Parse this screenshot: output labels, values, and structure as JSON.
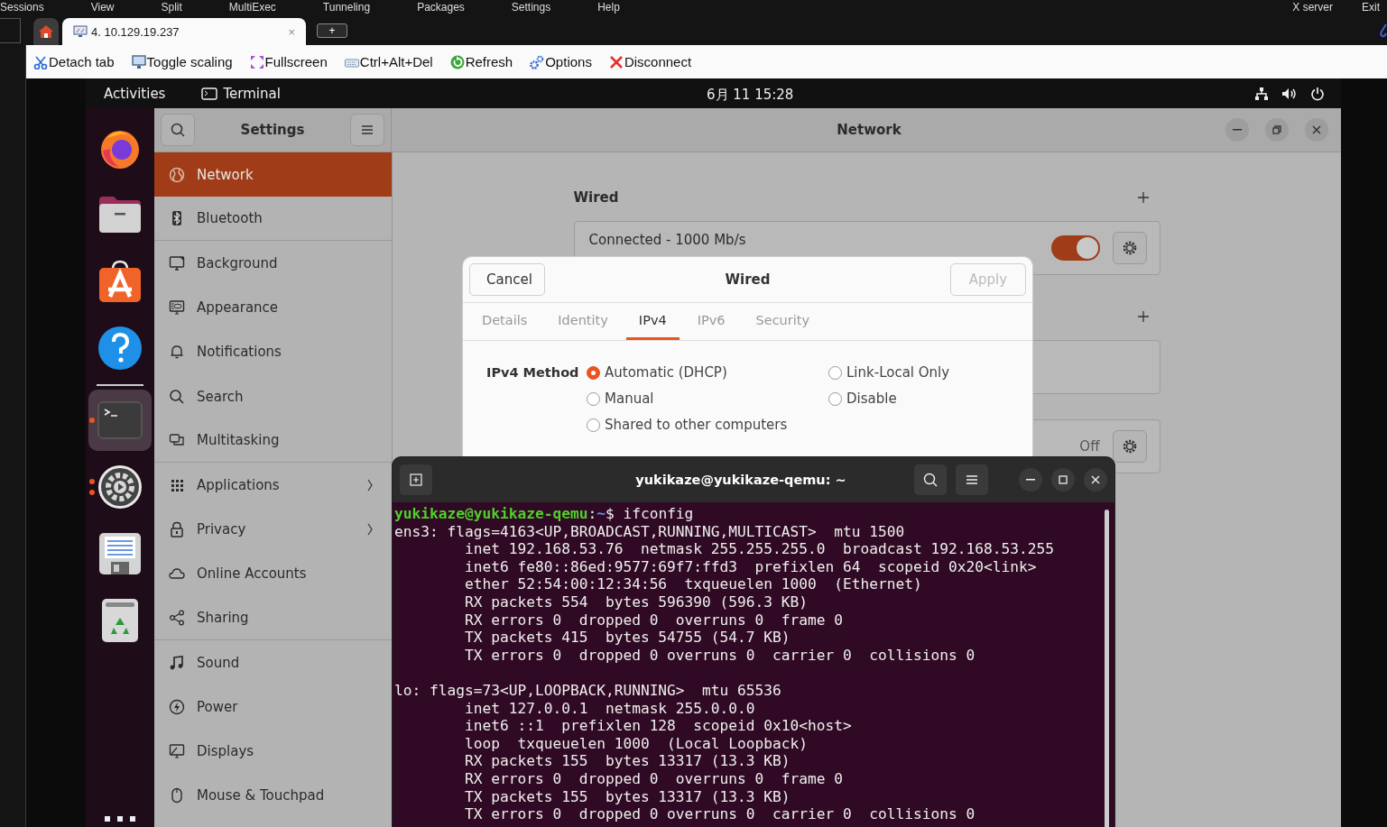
{
  "app_menu": {
    "items": [
      "Sessions",
      "View",
      "Split",
      "MultiExec",
      "Tunneling",
      "Packages",
      "Settings",
      "Help"
    ],
    "right_items": [
      "X server",
      "Exit"
    ]
  },
  "session_tabs": [
    {
      "kind": "home",
      "selected": false
    },
    {
      "kind": "session",
      "label": "4. 10.129.19.237",
      "close": "×",
      "selected": true
    },
    {
      "kind": "new",
      "label": "+"
    }
  ],
  "toolbar": [
    {
      "kind": "detach",
      "label": "Detach tab"
    },
    {
      "kind": "scaling",
      "label": "Toggle scaling"
    },
    {
      "kind": "fullscreen",
      "label": "Fullscreen"
    },
    {
      "kind": "keys",
      "label": "Ctrl+Alt+Del"
    },
    {
      "kind": "refresh",
      "label": "Refresh"
    },
    {
      "kind": "options",
      "label": "Options"
    },
    {
      "kind": "disconnect",
      "label": "Disconnect"
    }
  ],
  "top_bar": {
    "activities": "Activities",
    "app": "Terminal",
    "clock": "6月 11 15:28"
  },
  "dock": [
    {
      "kind": "browser",
      "running": false,
      "focused": false
    },
    {
      "kind": "files",
      "running": false,
      "focused": false
    },
    {
      "kind": "store",
      "running": false,
      "focused": false
    },
    {
      "kind": "help",
      "running": false,
      "focused": false
    },
    {
      "kind": "separator"
    },
    {
      "kind": "terminal",
      "running": true,
      "multiple_windows": false,
      "focused": true
    },
    {
      "kind": "settings",
      "running": true,
      "multiple_windows": true,
      "focused": false
    },
    {
      "kind": "editor",
      "running": false,
      "focused": false
    },
    {
      "kind": "trash",
      "running": false,
      "focused": false
    },
    {
      "kind": "grid",
      "focused": false
    }
  ],
  "settings": {
    "title": "Settings",
    "page_title": "Network",
    "sidebar": [
      {
        "kind": "network",
        "label": "Network",
        "selected": true,
        "submenu": false,
        "group_end": false
      },
      {
        "kind": "bluetooth",
        "label": "Bluetooth",
        "selected": false,
        "submenu": false,
        "group_end": true
      },
      {
        "kind": "background",
        "label": "Background",
        "selected": false,
        "submenu": false,
        "group_end": false
      },
      {
        "kind": "appearance",
        "label": "Appearance",
        "selected": false,
        "submenu": false,
        "group_end": false
      },
      {
        "kind": "notifications",
        "label": "Notifications",
        "selected": false,
        "submenu": false,
        "group_end": false
      },
      {
        "kind": "search",
        "label": "Search",
        "selected": false,
        "submenu": false,
        "group_end": false
      },
      {
        "kind": "multitasking",
        "label": "Multitasking",
        "selected": false,
        "submenu": false,
        "group_end": true
      },
      {
        "kind": "applications",
        "label": "Applications",
        "selected": false,
        "submenu": true,
        "group_end": false
      },
      {
        "kind": "privacy",
        "label": "Privacy",
        "selected": false,
        "submenu": true,
        "group_end": false
      },
      {
        "kind": "cloud",
        "label": "Online Accounts",
        "selected": false,
        "submenu": false,
        "group_end": false
      },
      {
        "kind": "sharing",
        "label": "Sharing",
        "selected": false,
        "submenu": false,
        "group_end": true
      },
      {
        "kind": "sound",
        "label": "Sound",
        "selected": false,
        "submenu": false,
        "group_end": false
      },
      {
        "kind": "power",
        "label": "Power",
        "selected": false,
        "submenu": false,
        "group_end": false
      },
      {
        "kind": "displays",
        "label": "Displays",
        "selected": false,
        "submenu": false,
        "group_end": false
      },
      {
        "kind": "mouse",
        "label": "Mouse & Touchpad",
        "selected": false,
        "submenu": false,
        "group_end": false
      }
    ],
    "sections": [
      {
        "title": "Wired",
        "add": true,
        "cards": [
          {
            "kind": "toggle",
            "label": "Connected - 1000 Mb/s",
            "on": true
          }
        ]
      },
      {
        "add": true,
        "cards": [
          {
            "kind": "blank"
          }
        ]
      },
      {
        "add": false,
        "cards": [
          {
            "kind": "status",
            "status": "Off"
          }
        ]
      }
    ]
  },
  "dialog": {
    "cancel": "Cancel",
    "title": "Wired",
    "apply": "Apply",
    "apply_disabled": true,
    "tabs": [
      {
        "label": "Details",
        "selected": false
      },
      {
        "label": "Identity",
        "selected": false
      },
      {
        "label": "IPv4",
        "selected": true
      },
      {
        "label": "IPv6",
        "selected": false
      },
      {
        "label": "Security",
        "selected": false
      }
    ],
    "method_label": "IPv4 Method",
    "options": [
      {
        "label": "Automatic (DHCP)",
        "selected": true
      },
      {
        "label": "Link-Local Only",
        "selected": false
      },
      {
        "label": "Manual",
        "selected": false
      },
      {
        "label": "Disable",
        "selected": false
      },
      {
        "label": "Shared to other computers",
        "selected": false
      }
    ]
  },
  "terminal": {
    "title": "yukikaze@yukikaze-qemu: ~",
    "lines": [
      {
        "kind": "prompt",
        "user": "yukikaze@yukikaze-qemu",
        "sep": ":",
        "path": "~",
        "command": "$ ifconfig"
      },
      {
        "kind": "output",
        "text": "ens3: flags=4163<UP,BROADCAST,RUNNING,MULTICAST>  mtu 1500"
      },
      {
        "kind": "output",
        "text": "        inet 192.168.53.76  netmask 255.255.255.0  broadcast 192.168.53.255"
      },
      {
        "kind": "output",
        "text": "        inet6 fe80::86ed:9577:69f7:ffd3  prefixlen 64  scopeid 0x20<link>"
      },
      {
        "kind": "output",
        "text": "        ether 52:54:00:12:34:56  txqueuelen 1000  (Ethernet)"
      },
      {
        "kind": "output",
        "text": "        RX packets 554  bytes 596390 (596.3 KB)"
      },
      {
        "kind": "output",
        "text": "        RX errors 0  dropped 0  overruns 0  frame 0"
      },
      {
        "kind": "output",
        "text": "        TX packets 415  bytes 54755 (54.7 KB)"
      },
      {
        "kind": "output",
        "text": "        TX errors 0  dropped 0 overruns 0  carrier 0  collisions 0"
      },
      {
        "kind": "blank"
      },
      {
        "kind": "output",
        "text": "lo: flags=73<UP,LOOPBACK,RUNNING>  mtu 65536"
      },
      {
        "kind": "output",
        "text": "        inet 127.0.0.1  netmask 255.0.0.0"
      },
      {
        "kind": "output",
        "text": "        inet6 ::1  prefixlen 128  scopeid 0x10<host>"
      },
      {
        "kind": "output",
        "text": "        loop  txqueuelen 1000  (Local Loopback)"
      },
      {
        "kind": "output",
        "text": "        RX packets 155  bytes 13317 (13.3 KB)"
      },
      {
        "kind": "output",
        "text": "        RX errors 0  dropped 0  overruns 0  frame 0"
      },
      {
        "kind": "output",
        "text": "        TX packets 155  bytes 13317 (13.3 KB)"
      },
      {
        "kind": "output",
        "text": "        TX errors 0  dropped 0 overruns 0  carrier 0  collisions 0"
      }
    ]
  }
}
